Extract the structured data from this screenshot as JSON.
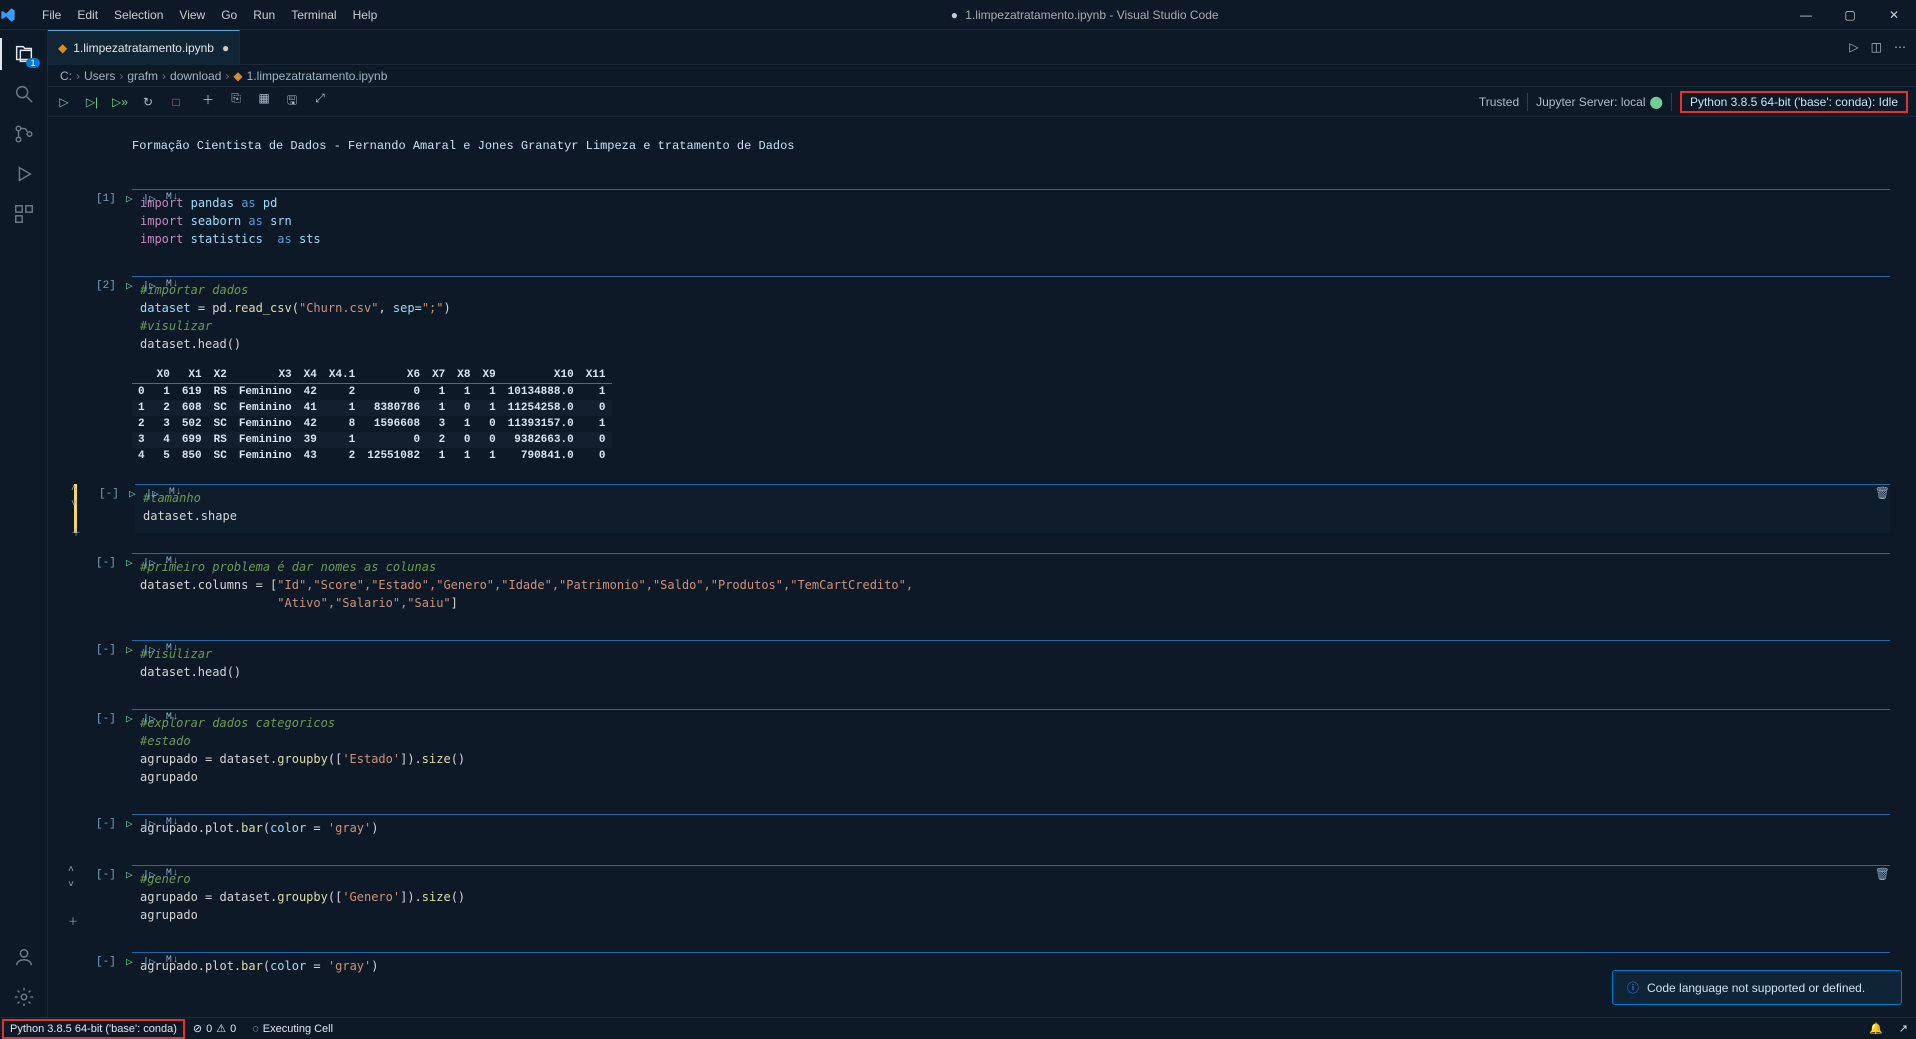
{
  "title": {
    "prefix": "●",
    "file": "1.limpezatratamento.ipynb",
    "app": "Visual Studio Code"
  },
  "menu": [
    "File",
    "Edit",
    "Selection",
    "View",
    "Go",
    "Run",
    "Terminal",
    "Help"
  ],
  "activitybar": {
    "badge": "1"
  },
  "tab": {
    "name": "1.limpezatratamento.ipynb"
  },
  "breadcrumb": [
    "C:",
    "Users",
    "grafm",
    "download",
    "1.limpezatratamento.ipynb"
  ],
  "nb_toolbar_right": {
    "trusted": "Trusted",
    "jupyter": "Jupyter Server: local",
    "kernel": "Python 3.8.5 64-bit ('base': conda): Idle"
  },
  "markdown_header": "Formação Cientista de Dados - Fernando Amaral e Jones Granatyr Limpeza e tratamento de Dados",
  "cells": {
    "c1": {
      "exec": "[1]",
      "ml": "M↓",
      "l1_kw": "import",
      "l1_mod": "pandas",
      "l1_as": "as",
      "l1_al": "pd",
      "l2_kw": "import",
      "l2_mod": "seaborn",
      "l2_as": "as",
      "l2_al": "srn",
      "l3_kw": "import",
      "l3_mod": "statistics",
      "l3_as": "as",
      "l3_al": "sts"
    },
    "c2": {
      "exec": "[2]",
      "ml": "M↓",
      "cmt1": "#importar dados",
      "l1_a": "dataset",
      "l1_b": "= pd.",
      "l1_fn": "read_csv",
      "l1_c": "(",
      "l1_s1": "\"Churn.csv\"",
      "l1_d": ", ",
      "l1_arg": "sep",
      "l1_e": "=",
      "l1_s2": "\";\"",
      "l1_f": ")",
      "cmt2": "#visulizar",
      "l2": "dataset.head()"
    },
    "c3": {
      "exec": "[-]",
      "ml": "M↓",
      "cmt": "#tamanho",
      "l1": "dataset.shape"
    },
    "c4": {
      "exec": "[-]",
      "ml": "M↓",
      "cmt": "#primeiro problema é dar nomes as colunas",
      "l1_a": "dataset.columns = [",
      "l1_s": "\"Id\",\"Score\",\"Estado\",\"Genero\",\"Idade\",\"Patrimonio\",\"Saldo\",\"Produtos\",\"TemCartCredito\",",
      "l2_s": "                   \"Ativo\",\"Salario\",\"Saiu\"",
      "l2_b": "]"
    },
    "c5": {
      "exec": "[-]",
      "ml": "M↓",
      "cmt": "#visulizar",
      "l1": "dataset.head()"
    },
    "c6": {
      "exec": "[-]",
      "ml": "M↓",
      "cmt1": "#explorar dados categoricos",
      "cmt2": "#estado",
      "l1_a": "agrupado = dataset.",
      "l1_fn": "groupby",
      "l1_b": "([",
      "l1_s": "'Estado'",
      "l1_c": "]).",
      "l1_fn2": "size",
      "l1_d": "()",
      "l2": "agrupado"
    },
    "c7": {
      "exec": "[-]",
      "ml": "M↓",
      "l1_a": "agrupado.plot.",
      "l1_fn": "bar",
      "l1_b": "(",
      "l1_arg": "color",
      "l1_c": " = ",
      "l1_s": "'gray'",
      "l1_d": ")"
    },
    "c8": {
      "exec": "[-]",
      "ml": "M↓",
      "cmt": "#genero",
      "l1_a": "agrupado = dataset.",
      "l1_fn": "groupby",
      "l1_b": "([",
      "l1_s": "'Genero'",
      "l1_c": "]).",
      "l1_fn2": "size",
      "l1_d": "()",
      "l2": "agrupado"
    },
    "c9": {
      "exec": "[-]",
      "ml": "M↓",
      "l1_a": "agrupado.plot.",
      "l1_fn": "bar",
      "l1_b": "(",
      "l1_arg": "color",
      "l1_c": " = ",
      "l1_s": "'gray'",
      "l1_d": ")"
    }
  },
  "df": {
    "cols": [
      "",
      "X0",
      "X1",
      "X2",
      "X3",
      "X4",
      "X4.1",
      "X6",
      "X7",
      "X8",
      "X9",
      "X10",
      "X11"
    ],
    "rows": [
      [
        "0",
        "1",
        "619",
        "RS",
        "Feminino",
        "42",
        "2",
        "0",
        "1",
        "1",
        "1",
        "10134888.0",
        "1"
      ],
      [
        "1",
        "2",
        "608",
        "SC",
        "Feminino",
        "41",
        "1",
        "8380786",
        "1",
        "0",
        "1",
        "11254258.0",
        "0"
      ],
      [
        "2",
        "3",
        "502",
        "SC",
        "Feminino",
        "42",
        "8",
        "1596608",
        "3",
        "1",
        "0",
        "11393157.0",
        "1"
      ],
      [
        "3",
        "4",
        "699",
        "RS",
        "Feminino",
        "39",
        "1",
        "0",
        "2",
        "0",
        "0",
        "9382663.0",
        "0"
      ],
      [
        "4",
        "5",
        "850",
        "SC",
        "Feminino",
        "43",
        "2",
        "12551082",
        "1",
        "1",
        "1",
        "790841.0",
        "0"
      ]
    ]
  },
  "notification": "Code language not supported or defined.",
  "statusbar": {
    "python": "Python 3.8.5 64-bit ('base': conda)",
    "errors": "0",
    "warnings": "0",
    "executing": "Executing Cell"
  }
}
